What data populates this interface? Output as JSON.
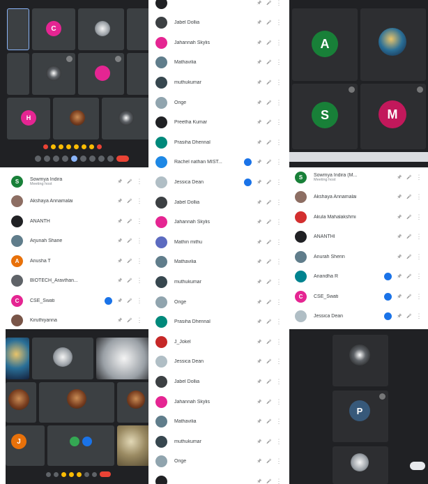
{
  "panel_a": {
    "tiles": [
      {
        "name": "",
        "initial": "",
        "color": "#3c4043"
      },
      {
        "name": "",
        "initial": "C",
        "color": "#e52592"
      },
      {
        "name": "",
        "initial": "",
        "color": "#3c4043"
      },
      {
        "name": "",
        "initial": "",
        "color": "#3c4043"
      },
      {
        "name": "",
        "initial": "",
        "color": "#3c4043"
      },
      {
        "name": "",
        "initial": "",
        "color": "#3c4043"
      },
      {
        "name": "",
        "initial": "",
        "color": "#e52592"
      },
      {
        "name": "",
        "initial": "",
        "color": "#3c4043"
      },
      {
        "name": "",
        "initial": "H",
        "color": "#e52592"
      },
      {
        "name": "",
        "initial": "",
        "color": "#3c4043"
      },
      {
        "name": "",
        "initial": "",
        "color": "#3c4043"
      }
    ]
  },
  "panel_b": {
    "participants": [
      {
        "name": "Sowmya Indira",
        "sub": "Meeting host",
        "initial": "S",
        "color": "#188038"
      },
      {
        "name": "Akshaya Annamalai",
        "sub": "",
        "initial": "",
        "color": "#8d6e63"
      },
      {
        "name": "ANANTH",
        "sub": "",
        "initial": "",
        "color": "#202124"
      },
      {
        "name": "Arjunah Sharie",
        "sub": "",
        "initial": "",
        "color": "#607d8b"
      },
      {
        "name": "Anusha T",
        "sub": "",
        "initial": "A",
        "color": "#e8710a"
      },
      {
        "name": "BIOTECH_Aravthan...",
        "sub": "",
        "initial": "",
        "color": "#5f6368"
      },
      {
        "name": "CSE_Swati",
        "sub": "",
        "initial": "C",
        "color": "#e52592"
      },
      {
        "name": "Kiruthiyanna",
        "sub": "",
        "initial": "",
        "color": "#795548"
      }
    ]
  },
  "panel_c": {
    "participants": [
      {
        "name": "",
        "initial": "",
        "color": "#202124"
      },
      {
        "name": "Jabel Dollia",
        "initial": "",
        "color": "#3c4043"
      },
      {
        "name": "Jahannah Skylis",
        "initial": "",
        "color": "#e52592"
      },
      {
        "name": "Mathavilia",
        "initial": "",
        "color": "#607d8b"
      },
      {
        "name": "muthukumar",
        "initial": "",
        "color": "#37474f"
      },
      {
        "name": "Orige",
        "initial": "",
        "color": "#90a4ae"
      },
      {
        "name": "Preetha Kumar",
        "initial": "",
        "color": "#202124"
      },
      {
        "name": "Prasiha Dhennal",
        "initial": "",
        "color": "#00897b"
      },
      {
        "name": "Rachel nathan MIST...",
        "initial": "",
        "color": "#1e88e5"
      },
      {
        "name": "Jessica Dean",
        "initial": "",
        "color": "#b0bec5"
      },
      {
        "name": "Jabel Dollia",
        "initial": "",
        "color": "#3c4043"
      },
      {
        "name": "Jahannah Skylis",
        "initial": "",
        "color": "#e52592"
      },
      {
        "name": "Mathin mithu",
        "initial": "",
        "color": "#5c6bc0"
      },
      {
        "name": "Mathavilia",
        "initial": "",
        "color": "#607d8b"
      },
      {
        "name": "muthukumar",
        "initial": "",
        "color": "#37474f"
      },
      {
        "name": "Orige",
        "initial": "",
        "color": "#90a4ae"
      },
      {
        "name": "Prasiha Dhennal",
        "initial": "",
        "color": "#00897b"
      },
      {
        "name": "J_Jokel",
        "initial": "",
        "color": "#c62828"
      },
      {
        "name": "Jessica Dean",
        "initial": "",
        "color": "#b0bec5"
      },
      {
        "name": "Jabel Dollia",
        "initial": "",
        "color": "#3c4043"
      },
      {
        "name": "Jahannah Skylis",
        "initial": "",
        "color": "#e52592"
      },
      {
        "name": "Mathavilia",
        "initial": "",
        "color": "#607d8b"
      },
      {
        "name": "muthukumar",
        "initial": "",
        "color": "#37474f"
      },
      {
        "name": "Orige",
        "initial": "",
        "color": "#90a4ae"
      },
      {
        "name": "",
        "initial": "",
        "color": "#202124"
      }
    ]
  },
  "panel_d": {
    "tiles": [
      {
        "name": "",
        "initial": "A",
        "color": "#188038"
      },
      {
        "name": "",
        "initial": "",
        "color": "#3c4043"
      },
      {
        "name": "",
        "initial": "S",
        "color": "#188038"
      },
      {
        "name": "",
        "initial": "M",
        "color": "#c2185b"
      }
    ],
    "bottom_note": ""
  },
  "panel_e": {
    "participants": [
      {
        "name": "Sowmya Indira (M...",
        "sub": "Meeting host",
        "initial": "S",
        "color": "#188038"
      },
      {
        "name": "Akshaya Annamalai",
        "sub": "",
        "initial": "",
        "color": "#8d6e63"
      },
      {
        "name": "Akula Mahalakshmi",
        "sub": "",
        "initial": "",
        "color": "#d32f2f"
      },
      {
        "name": "ANANTHI",
        "sub": "",
        "initial": "",
        "color": "#202124"
      },
      {
        "name": "Anurah Sherin",
        "sub": "",
        "initial": "",
        "color": "#607d8b"
      },
      {
        "name": "Anandha R",
        "sub": "",
        "initial": "",
        "color": "#00838f"
      },
      {
        "name": "CSE_Swati",
        "sub": "",
        "initial": "C",
        "color": "#e52592"
      },
      {
        "name": "Jessica Dean",
        "sub": "",
        "initial": "",
        "color": "#b0bec5"
      }
    ]
  },
  "panel_f": {
    "tiles": [
      {
        "name": "",
        "initial": "",
        "color": "#3c4043"
      },
      {
        "name": "",
        "initial": "",
        "color": "#3c4043"
      },
      {
        "name": "",
        "initial": "",
        "color": "#3c4043"
      },
      {
        "name": "",
        "initial": "",
        "color": "#3c4043"
      },
      {
        "name": "",
        "initial": "",
        "color": "#3c4043"
      },
      {
        "name": "",
        "initial": "",
        "color": "#3c4043"
      },
      {
        "name": "",
        "initial": "J",
        "color": "#e8710a"
      },
      {
        "name": "",
        "initial": "",
        "color": "#3c4043"
      },
      {
        "name": "",
        "initial": "",
        "color": "#3c4043"
      }
    ]
  },
  "panel_g": {
    "tiles": [
      {
        "name": "",
        "initial": "",
        "color": "#3c4043"
      },
      {
        "name": "",
        "initial": "P",
        "color": "#37597a"
      },
      {
        "name": "",
        "initial": "",
        "color": "#3c4043"
      }
    ]
  },
  "icons": {
    "pin": "pin-icon",
    "mic": "mic-icon",
    "more": "more-vert-icon"
  },
  "colors": {
    "meet_dark": "#202124",
    "tile": "#3c4043",
    "end_call": "#ea4335",
    "accent_blue": "#1a73e8"
  }
}
